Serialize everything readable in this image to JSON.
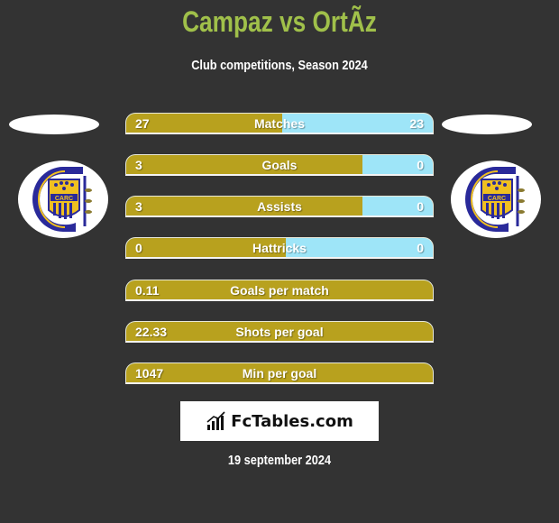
{
  "header": {
    "title": "Campaz vs OrtÃz",
    "subtitle": "Club competitions, Season 2024"
  },
  "teams": {
    "left": {
      "logo_icon": "rosario-central-crest-icon",
      "logo_text": "CARC"
    },
    "right": {
      "logo_icon": "rosario-central-crest-icon",
      "logo_text": "CARC"
    }
  },
  "colors": {
    "left_bar": "#b8a11e",
    "right_bar": "#9ee5f8",
    "title": "#a0c04a",
    "background": "#333333"
  },
  "stats": [
    {
      "label": "Matches",
      "left": "27",
      "right": "23",
      "left_share": 0.51
    },
    {
      "label": "Goals",
      "left": "3",
      "right": "0",
      "left_share": 0.77
    },
    {
      "label": "Assists",
      "left": "3",
      "right": "0",
      "left_share": 0.77
    },
    {
      "label": "Hattricks",
      "left": "0",
      "right": "0",
      "left_share": 0.52
    },
    {
      "label": "Goals per match",
      "left": "0.11",
      "right": "",
      "left_share": 1.0
    },
    {
      "label": "Shots per goal",
      "left": "22.33",
      "right": "",
      "left_share": 1.0
    },
    {
      "label": "Min per goal",
      "left": "1047",
      "right": "",
      "left_share": 1.0
    }
  ],
  "brand": {
    "name": "FcTables.com",
    "icon": "bar-chart-icon"
  },
  "footer": {
    "date": "19 september 2024"
  }
}
